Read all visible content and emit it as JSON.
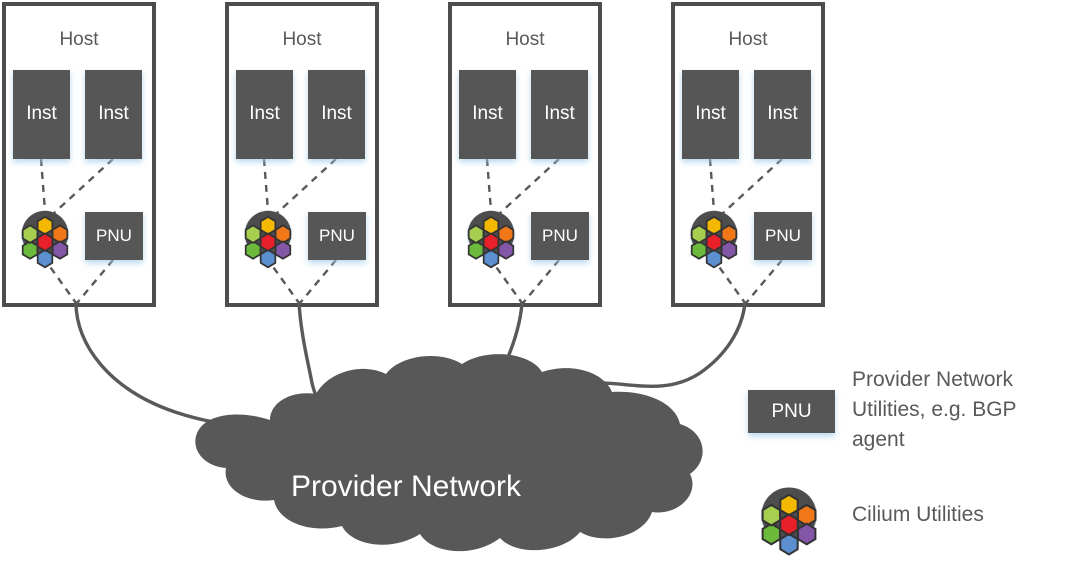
{
  "diagram": {
    "title_text": "Provider Network",
    "hosts": [
      {
        "label": "Host",
        "instances": [
          {
            "label": "Inst"
          },
          {
            "label": "Inst"
          }
        ],
        "pnu": {
          "label": "PNU"
        },
        "cilium": {
          "label": "cilium-logo-icon"
        }
      },
      {
        "label": "Host",
        "instances": [
          {
            "label": "Inst"
          },
          {
            "label": "Inst"
          }
        ],
        "pnu": {
          "label": "PNU"
        },
        "cilium": {
          "label": "cilium-logo-icon"
        }
      },
      {
        "label": "Host",
        "instances": [
          {
            "label": "Inst"
          },
          {
            "label": "Inst"
          }
        ],
        "pnu": {
          "label": "PNU"
        },
        "cilium": {
          "label": "cilium-logo-icon"
        }
      },
      {
        "label": "Host",
        "instances": [
          {
            "label": "Inst"
          },
          {
            "label": "Inst"
          }
        ],
        "pnu": {
          "label": "PNU"
        },
        "cilium": {
          "label": "cilium-logo-icon"
        }
      }
    ],
    "cloud": {
      "label": "Provider Network"
    },
    "legend": {
      "items": [
        {
          "symbol": "PNU",
          "symbol_kind": "dark-box",
          "text_lines": [
            "Provider Network",
            "Utilities, e.g. BGP",
            "agent"
          ],
          "text_full": "Provider Network Utilities, e.g. BGP agent"
        },
        {
          "symbol": "cilium-logo-icon",
          "symbol_kind": "cilium-circle",
          "text_lines": [
            "Cilium Utilities"
          ],
          "text_full": "Cilium Utilities"
        }
      ]
    }
  },
  "colors": {
    "box_fill": "#575757",
    "cloud_fill": "#585858",
    "host_border": "#4d4d4d",
    "label_gray": "#595959",
    "line_gray": "#595959",
    "white": "#ffffff",
    "glow_blue": "#d6e8f7",
    "cilium_circle": "#4d4d4d",
    "hex_center_red": "#e8202a",
    "hex_top_yellow": "#f5b800",
    "hex_topright_orange": "#f07818",
    "hex_bottomright_purple": "#8456a8",
    "hex_bottom_blue": "#5b8fd0",
    "hex_bottomleft_green": "#6cba3c",
    "hex_topleft_yellowgreen": "#a8ce4f"
  }
}
